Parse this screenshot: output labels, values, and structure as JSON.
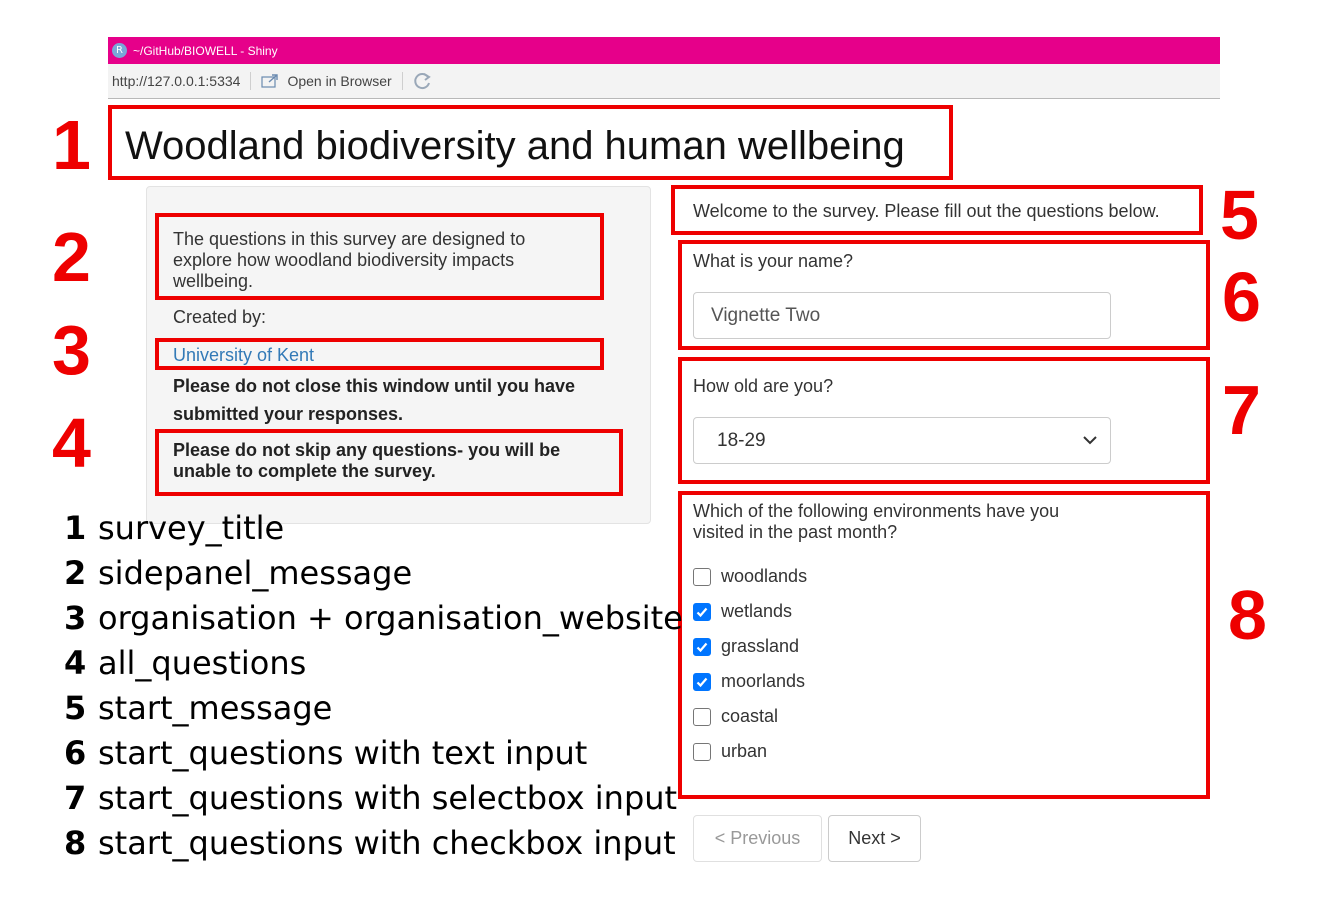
{
  "window": {
    "title": "~/GitHub/BIOWELL - Shiny",
    "url": "http://127.0.0.1:5334",
    "open_in_browser_label": "Open in Browser"
  },
  "survey_title": "Woodland biodiversity and human wellbeing",
  "sidepanel": {
    "message": "The questions in this survey are designed to explore how woodland biodiversity impacts wellbeing.",
    "created_by_label": "Created by:",
    "organisation": "University of Kent",
    "close_warning": "Please do not close this window until you have submitted your responses.",
    "skip_warning": "Please do not skip any questions- you will be unable to complete the survey."
  },
  "main": {
    "start_message": "Welcome to the survey. Please fill out the questions below.",
    "name_question": "What is your name?",
    "name_value": "Vignette Two",
    "age_question": "How old are you?",
    "age_selected": "18-29",
    "env_question": "Which of the following environments have you visited in the past month?",
    "env_options": [
      {
        "label": "woodlands",
        "checked": false
      },
      {
        "label": "wetlands",
        "checked": true
      },
      {
        "label": "grassland",
        "checked": true
      },
      {
        "label": "moorlands",
        "checked": true
      },
      {
        "label": "coastal",
        "checked": false
      },
      {
        "label": "urban",
        "checked": false
      }
    ],
    "prev_label": "< Previous",
    "next_label": "Next >"
  },
  "annotations": {
    "numbers": [
      "1",
      "2",
      "3",
      "4",
      "5",
      "6",
      "7",
      "8"
    ],
    "legend": [
      {
        "num": "1",
        "text": "survey_title"
      },
      {
        "num": "2",
        "text": "sidepanel_message"
      },
      {
        "num": "3",
        "text": "organisation + organisation_website"
      },
      {
        "num": "4",
        "text": "all_questions"
      },
      {
        "num": "5",
        "text": "start_message"
      },
      {
        "num": "6",
        "text": "start_questions with text input"
      },
      {
        "num": "7",
        "text": "start_questions with selectbox input"
      },
      {
        "num": "8",
        "text": "start_questions with checkbox input"
      }
    ],
    "color": "#ee0000"
  }
}
